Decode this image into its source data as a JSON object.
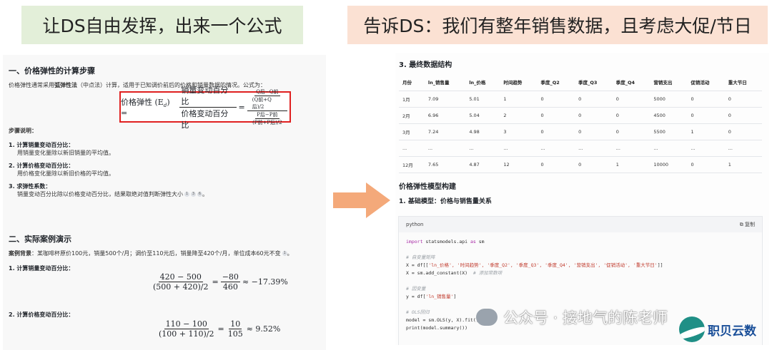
{
  "banner_left": "让DS自由发挥，出来一个公式",
  "banner_right": "告诉DS：我们有整年销售数据，且考虑大促/节日",
  "left": {
    "section1_title": "一、价格弹性的计算步骤",
    "intro_a": "价格弹性通常采用",
    "intro_bold": "弧弹性法",
    "intro_b": "（中点法）计算，适用于已知调价前后的价格和销量数据的情况。公式为：",
    "formula": {
      "lhs": "价格弹性 (E",
      "lhs_sub": "d",
      "lhs_end": ") =",
      "num": "销量变动百分比",
      "den": "价格变动百分比",
      "eq": "=",
      "q_num": "Q后−Q前",
      "q_den": "(Q前+Q后)/2",
      "p_num": "P后−P前",
      "p_den": "(P前+P后)/2"
    },
    "steps_title": "步骤说明：",
    "step1": "1. 计算销量变动百分比：",
    "step1_desc": "用销量变化量除以新旧销量的平均值。",
    "step2": "2. 计算价格变动百分比：",
    "step2_desc": "用价格变化量除以新旧价格的平均值。",
    "step3": "3. 求弹性系数：",
    "step3_desc": "销量变动百分比除以价格变动百分比，结果取绝对值判断弹性大小",
    "cites": [
      "1",
      "3",
      "6"
    ],
    "section2_title": "二、实际案例演示",
    "case_label": "案例背景",
    "case_text": "：某咖啡杯原价100元，销量500个/月；调价至110元后，销量降至420个/月，单位成本60元不变",
    "case_cite": "1",
    "calc1_title": "1. 计算销量变动百分比：",
    "calc1": {
      "num": "420 − 500",
      "den": "(500 + 420)/2",
      "eq1": "=",
      "num2": "−80",
      "den2": "460",
      "result": "≈ −17.39%"
    },
    "calc2_title": "2. 计算价格变动百分比：",
    "calc2": {
      "num": "110 − 100",
      "den": "(100 + 110)/2",
      "eq1": "=",
      "num2": "10",
      "den2": "105",
      "result": "≈ 9.52%"
    }
  },
  "right": {
    "section3_title": "3. 最终数据结构",
    "table": {
      "headers": [
        "月份",
        "ln_销售量",
        "ln_价格",
        "时间趋势",
        "季度_Q2",
        "季度_Q3",
        "季度_Q4",
        "营销支出",
        "促销活动",
        "重大节日"
      ],
      "rows": [
        [
          "1月",
          "7.09",
          "5.01",
          "1",
          "0",
          "0",
          "0",
          "5000",
          "0",
          "0"
        ],
        [
          "2月",
          "6.96",
          "5.04",
          "2",
          "0",
          "0",
          "0",
          "4500",
          "0",
          "0"
        ],
        [
          "3月",
          "7.24",
          "4.98",
          "3",
          "0",
          "0",
          "0",
          "5500",
          "1",
          "0"
        ],
        [
          "...",
          "...",
          "...",
          "...",
          "...",
          "...",
          "...",
          "...",
          "...",
          "..."
        ],
        [
          "12月",
          "7.65",
          "4.87",
          "12",
          "0",
          "0",
          "1",
          "10000",
          "0",
          "1"
        ]
      ]
    },
    "model_title": "价格弹性模型构建",
    "model_sub": "1. 基础模型：价格与销售量关系",
    "code_lang": "python",
    "copy_label": "复制",
    "code": {
      "l1_kw1": "import",
      "l1_mid": " statsmodels.api ",
      "l1_kw2": "as",
      "l1_end": " sm",
      "c1": "# 自变量矩阵",
      "l2_a": "X = df[[",
      "l2_str": "'ln_价格', '时间趋势', '季度_Q2', '季度_Q3', '季度_Q4', '营销支出', '促销活动', '重大节日'",
      "l2_b": "]]",
      "l3_code": "X = sm.add_constant(X)  ",
      "l3_cm": "# 添加常数项",
      "c2": "# 因变量",
      "l4_a": "y = df[",
      "l4_str": "'ln_销售量'",
      "l4_b": "]",
      "c3": "# OLS回归",
      "l5": "model = sm.OLS(y, X).fit()",
      "l6": "print(model.summary())"
    }
  },
  "watermark": "公众号 · 接地气的陈老师",
  "logo": "职贝云数",
  "colors": {
    "highlight": "#e02020",
    "arrow": "#f4a97a",
    "banner_left": "#e3efd9",
    "banner_right": "#fbe1d3"
  }
}
